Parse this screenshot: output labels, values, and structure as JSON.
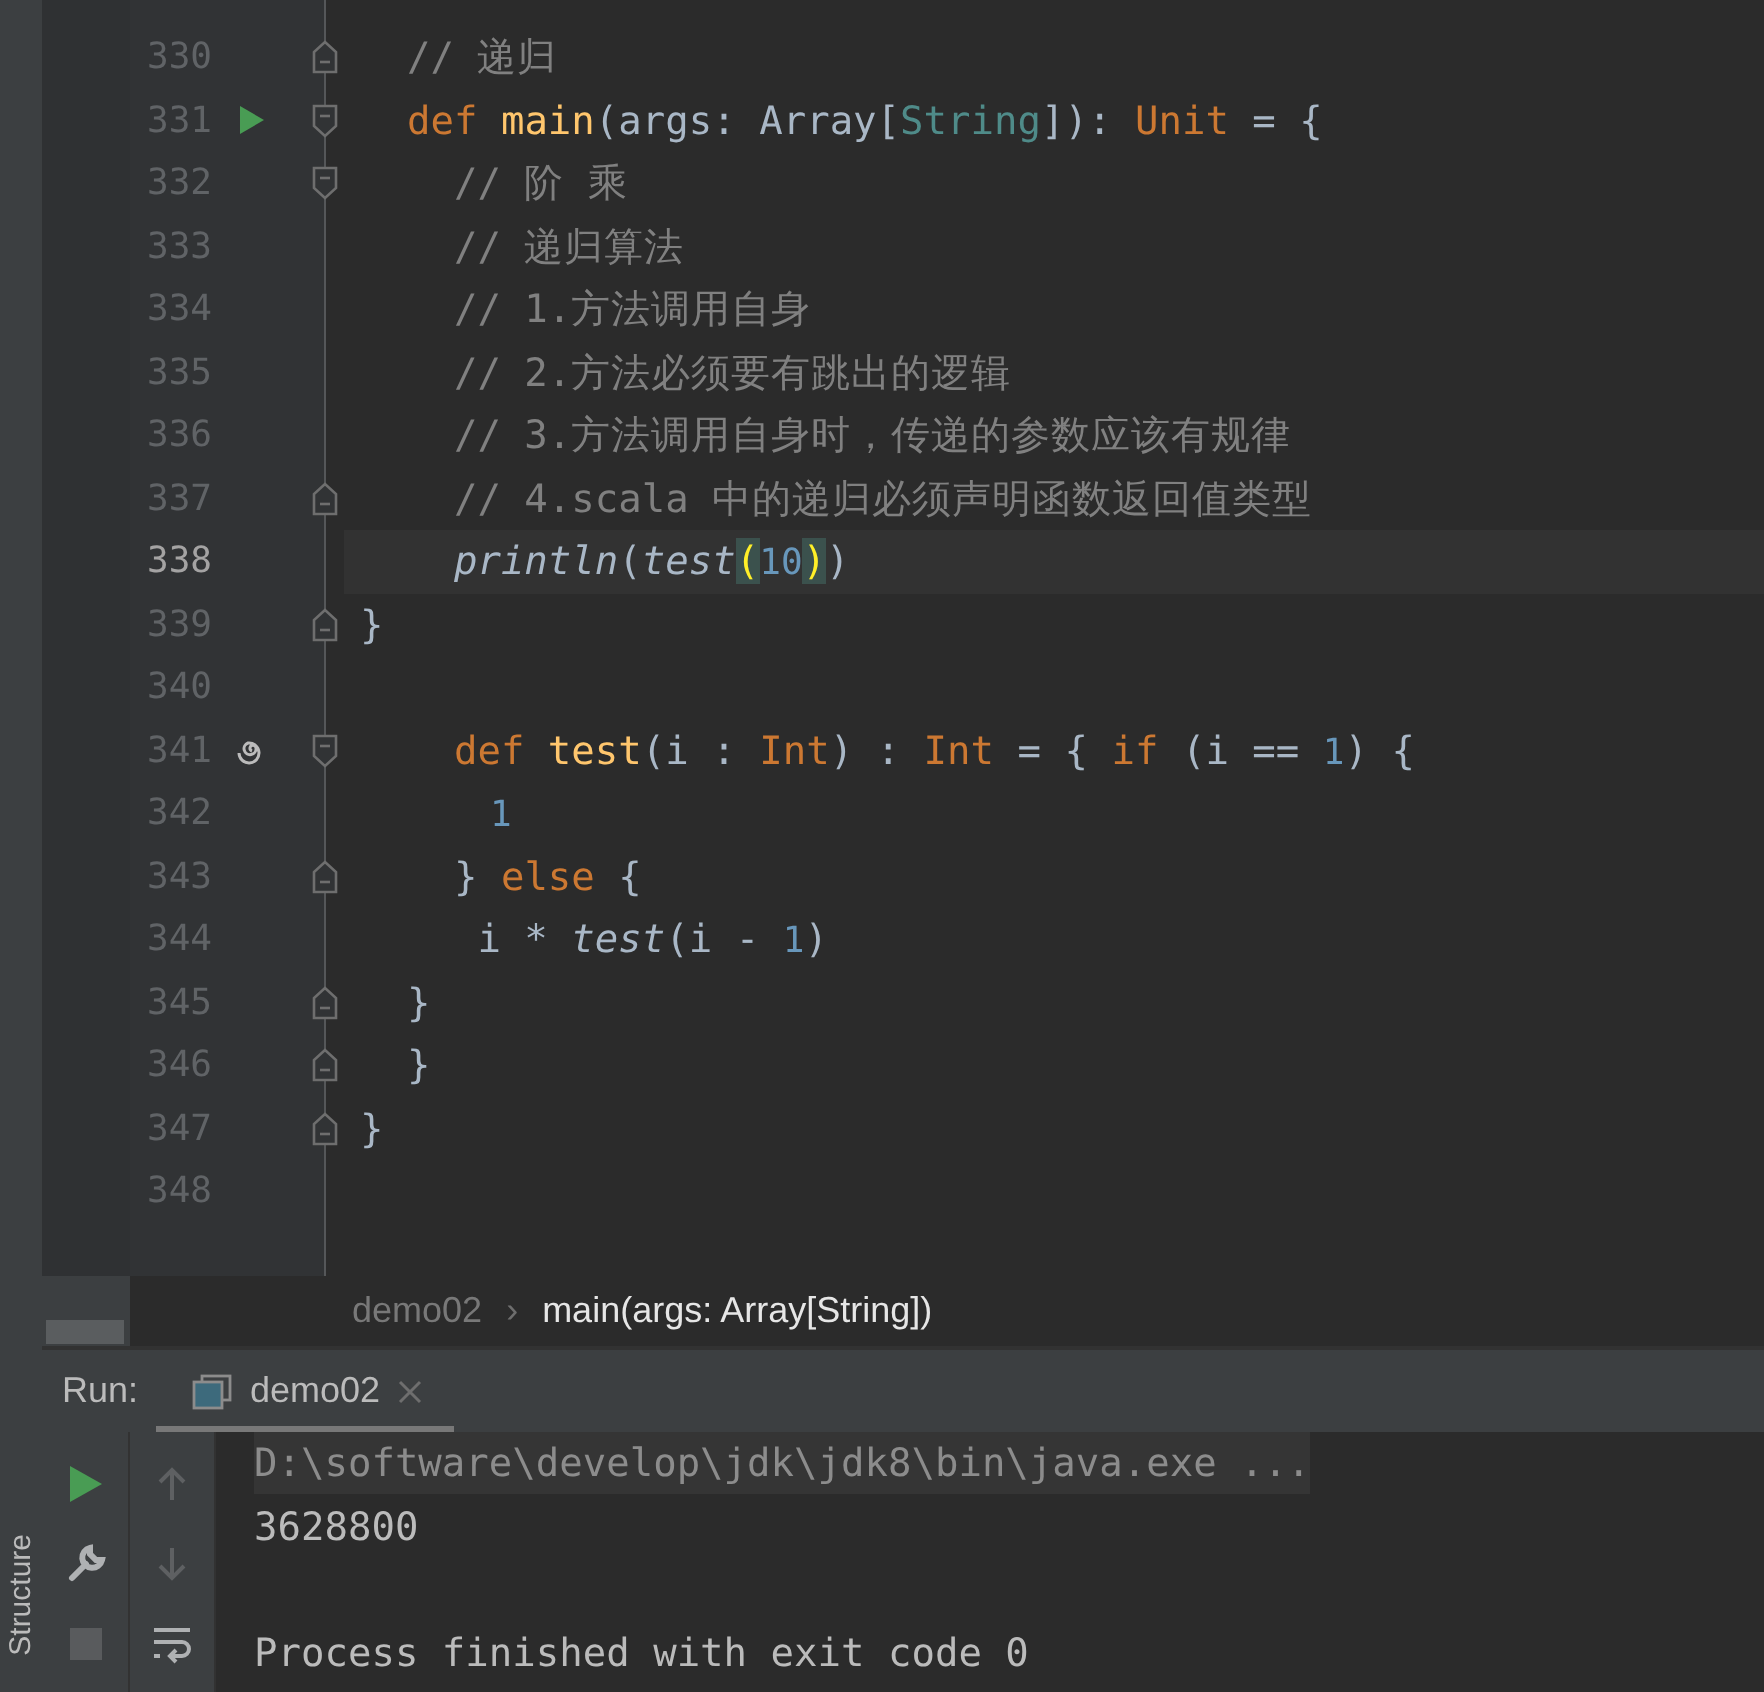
{
  "editor": {
    "lines": [
      {
        "number": "330",
        "current": false,
        "fold_start": false,
        "fold_end": true,
        "run": false,
        "recursion": false,
        "tokens": [
          {
            "text": "  // 递归",
            "kind": "comment"
          }
        ]
      },
      {
        "number": "331",
        "current": false,
        "fold_start": true,
        "fold_end": false,
        "run": true,
        "recursion": false,
        "tokens": [
          {
            "text": "  def ",
            "kind": "kw"
          },
          {
            "text": "main",
            "kind": "fn"
          },
          {
            "text": "(args: Array[",
            "kind": "plain"
          },
          {
            "text": "String",
            "kind": "type"
          },
          {
            "text": "]): ",
            "kind": "plain"
          },
          {
            "text": "Unit",
            "kind": "kw"
          },
          {
            "text": " = {",
            "kind": "plain"
          }
        ]
      },
      {
        "number": "332",
        "current": false,
        "fold_start": true,
        "fold_end": false,
        "run": false,
        "recursion": false,
        "tokens": [
          {
            "text": "    // 阶 乘",
            "kind": "comment"
          }
        ]
      },
      {
        "number": "333",
        "current": false,
        "fold_start": false,
        "fold_end": false,
        "run": false,
        "recursion": false,
        "tokens": [
          {
            "text": "    // 递归算法",
            "kind": "comment"
          }
        ]
      },
      {
        "number": "334",
        "current": false,
        "fold_start": false,
        "fold_end": false,
        "run": false,
        "recursion": false,
        "tokens": [
          {
            "text": "    // 1.方法调用自身",
            "kind": "comment"
          }
        ]
      },
      {
        "number": "335",
        "current": false,
        "fold_start": false,
        "fold_end": false,
        "run": false,
        "recursion": false,
        "tokens": [
          {
            "text": "    // 2.方法必须要有跳出的逻辑",
            "kind": "comment"
          }
        ]
      },
      {
        "number": "336",
        "current": false,
        "fold_start": false,
        "fold_end": false,
        "run": false,
        "recursion": false,
        "tokens": [
          {
            "text": "    // 3.方法调用自身时，传递的参数应该有规律",
            "kind": "comment"
          }
        ]
      },
      {
        "number": "337",
        "current": false,
        "fold_start": false,
        "fold_end": true,
        "run": false,
        "recursion": false,
        "tokens": [
          {
            "text": "    // 4.scala 中的递归必须声明函数返回值类型",
            "kind": "comment"
          }
        ]
      },
      {
        "number": "338",
        "current": true,
        "fold_start": false,
        "fold_end": false,
        "run": false,
        "recursion": false,
        "tokens": [
          {
            "text": "    println",
            "kind": "call"
          },
          {
            "text": "(",
            "kind": "plain"
          },
          {
            "text": "test",
            "kind": "call"
          },
          {
            "text": "(",
            "kind": "match"
          },
          {
            "text": "10",
            "kind": "num"
          },
          {
            "text": ")",
            "kind": "match"
          },
          {
            "text": ")",
            "kind": "plain"
          }
        ]
      },
      {
        "number": "339",
        "current": false,
        "fold_start": false,
        "fold_end": true,
        "run": false,
        "recursion": false,
        "tokens": [
          {
            "text": "}",
            "kind": "plain"
          }
        ]
      },
      {
        "number": "340",
        "current": false,
        "fold_start": false,
        "fold_end": false,
        "run": false,
        "recursion": false
      },
      {
        "number": "341",
        "current": false,
        "fold_start": true,
        "fold_end": false,
        "run": false,
        "recursion": true,
        "tokens": [
          {
            "text": "    def ",
            "kind": "kw"
          },
          {
            "text": "test",
            "kind": "fn"
          },
          {
            "text": "(i : ",
            "kind": "plain"
          },
          {
            "text": "Int",
            "kind": "kw"
          },
          {
            "text": ") : ",
            "kind": "plain"
          },
          {
            "text": "Int",
            "kind": "kw"
          },
          {
            "text": " = { ",
            "kind": "plain"
          },
          {
            "text": "if",
            "kind": "kw"
          },
          {
            "text": " (i == ",
            "kind": "plain"
          },
          {
            "text": "1",
            "kind": "num"
          },
          {
            "text": ") {",
            "kind": "plain"
          }
        ]
      },
      {
        "number": "342",
        "current": false,
        "fold_start": false,
        "fold_end": false,
        "run": false,
        "recursion": false,
        "tokens": [
          {
            "text": "      1",
            "kind": "num"
          }
        ]
      },
      {
        "number": "343",
        "current": false,
        "fold_start": false,
        "fold_end": true,
        "run": false,
        "recursion": false,
        "tokens": [
          {
            "text": "    } ",
            "kind": "plain"
          },
          {
            "text": "else",
            "kind": "kw"
          },
          {
            "text": " {",
            "kind": "plain"
          }
        ]
      },
      {
        "number": "344",
        "current": false,
        "fold_start": false,
        "fold_end": false,
        "run": false,
        "recursion": false,
        "tokens": [
          {
            "text": "     i * ",
            "kind": "plain"
          },
          {
            "text": "test",
            "kind": "call"
          },
          {
            "text": "(i - ",
            "kind": "plain"
          },
          {
            "text": "1",
            "kind": "num"
          },
          {
            "text": ")",
            "kind": "plain"
          }
        ]
      },
      {
        "number": "345",
        "current": false,
        "fold_start": false,
        "fold_end": true,
        "run": false,
        "recursion": false,
        "tokens": [
          {
            "text": "  }",
            "kind": "plain"
          }
        ]
      },
      {
        "number": "346",
        "current": false,
        "fold_start": false,
        "fold_end": true,
        "run": false,
        "recursion": false,
        "tokens": [
          {
            "text": "  }",
            "kind": "plain"
          }
        ]
      },
      {
        "number": "347",
        "current": false,
        "fold_start": false,
        "fold_end": true,
        "run": false,
        "recursion": false,
        "tokens": [
          {
            "text": "}",
            "kind": "plain"
          }
        ]
      },
      {
        "number": "348",
        "current": false,
        "fold_start": false,
        "fold_end": false,
        "run": false,
        "recursion": false
      }
    ]
  },
  "breadcrumb": {
    "separator": "›",
    "items": [
      {
        "label": "demo02",
        "selected": false
      },
      {
        "label": "main(args: Array[String])",
        "selected": true
      }
    ]
  },
  "run_panel": {
    "title": "Run:",
    "tabs": [
      {
        "label": "demo02",
        "selected": true
      }
    ],
    "toolbar": [
      {
        "kind": "run",
        "disabled": false
      },
      {
        "kind": "settings",
        "disabled": false
      },
      {
        "kind": "stop",
        "disabled": true
      }
    ],
    "nav_toolbar": [
      {
        "kind": "up",
        "disabled": true
      },
      {
        "kind": "down",
        "disabled": true
      },
      {
        "kind": "wrap",
        "disabled": false
      }
    ],
    "console": [
      {
        "kind": "command",
        "text": "D:\\software\\develop\\jdk\\jdk8\\bin\\java.exe ..."
      },
      {
        "kind": "output",
        "text": "3628800"
      },
      {
        "kind": "exit",
        "text": "Process finished with exit code 0"
      }
    ]
  },
  "tool_strip": {
    "label": "Structure"
  }
}
